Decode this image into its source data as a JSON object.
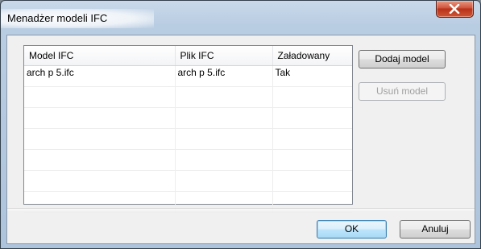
{
  "window": {
    "title": "Menadżer modeli IFC"
  },
  "table": {
    "columns": [
      "Model IFC",
      "Plik IFC",
      "Załadowany"
    ],
    "rows": [
      [
        "arch p 5.ifc",
        "arch p 5.ifc",
        "Tak"
      ],
      [
        "",
        "",
        ""
      ],
      [
        "",
        "",
        ""
      ],
      [
        "",
        "",
        ""
      ],
      [
        "",
        "",
        ""
      ],
      [
        "",
        "",
        ""
      ],
      [
        "",
        "",
        ""
      ]
    ]
  },
  "buttons": {
    "add_model": "Dodaj model",
    "remove_model": "Usuń model",
    "ok": "OK",
    "cancel": "Anuluj"
  },
  "colors": {
    "close_button": "#c7432a",
    "default_button_border": "#3c7fb1"
  },
  "icons": {
    "close": "close-icon"
  }
}
